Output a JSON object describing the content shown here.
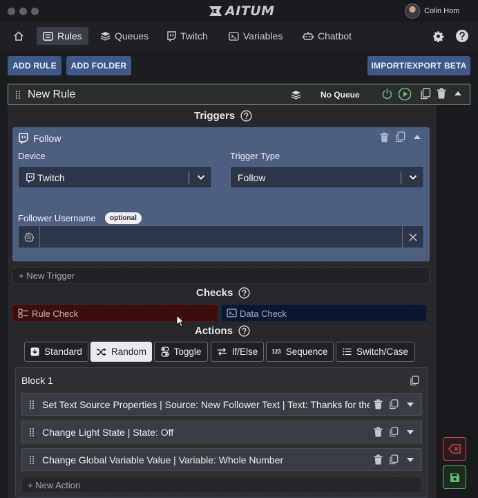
{
  "app": {
    "title": "AITUM"
  },
  "user": {
    "name": "Colin Hom"
  },
  "nav": {
    "items": [
      {
        "label": "Rules"
      },
      {
        "label": "Queues"
      },
      {
        "label": "Twitch"
      },
      {
        "label": "Variables"
      },
      {
        "label": "Chatbot"
      }
    ]
  },
  "toolbar": {
    "add_rule": "ADD RULE",
    "add_folder": "ADD FOLDER",
    "import_export": "IMPORT/EXPORT BETA"
  },
  "rule": {
    "name": "New Rule",
    "queue": "No Queue"
  },
  "triggers": {
    "heading": "Triggers",
    "card": {
      "title": "Follow",
      "device_label": "Device",
      "device_value": "Twitch",
      "type_label": "Trigger Type",
      "type_value": "Follow",
      "username_label": "Follower Username",
      "optional_badge": "optional",
      "username_value": ""
    },
    "new_trigger": "+ New Trigger"
  },
  "checks": {
    "heading": "Checks",
    "rule_check": "Rule Check",
    "data_check": "Data Check"
  },
  "actions": {
    "heading": "Actions",
    "types": [
      {
        "label": "Standard"
      },
      {
        "label": "Random",
        "selected": true
      },
      {
        "label": "Toggle"
      },
      {
        "label": "If/Else"
      },
      {
        "label": "Sequence"
      },
      {
        "label": "Switch/Case"
      }
    ],
    "block": {
      "title": "Block 1",
      "items": [
        {
          "label": "Set Text Source Properties | Source: New Follower Text | Text: Thanks for the follow"
        },
        {
          "label": "Change Light State | State: Off"
        },
        {
          "label": "Change Global Variable Value | Variable: Whole Number"
        }
      ],
      "new_action": "+ New Action"
    }
  },
  "colors": {
    "accent": "#3e5987",
    "rule_border": "#6bb26a",
    "trigger_card": "#4d5f80",
    "rule_check_bg": "#3d0e10",
    "data_check_bg": "#0c1730",
    "delete_red": "#c8454a",
    "save_green": "#5cbf6a"
  }
}
